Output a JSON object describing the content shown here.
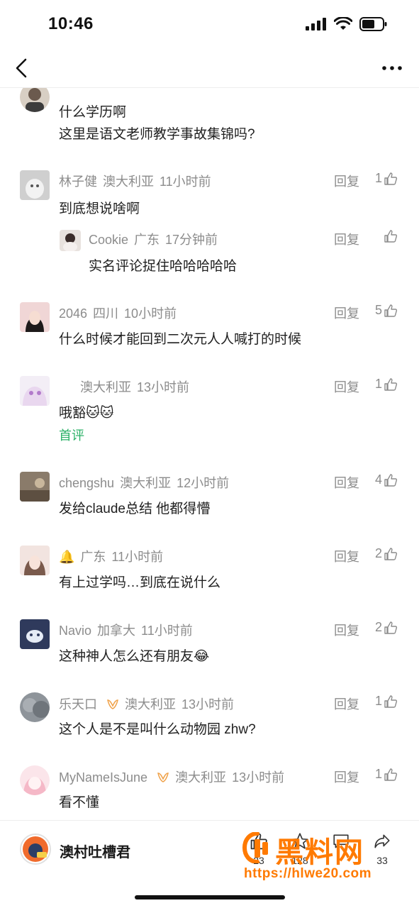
{
  "status_bar": {
    "time": "10:46"
  },
  "comments": [
    {
      "name": "",
      "location": "",
      "time": "",
      "text": "什么学历啊",
      "text2": "这里是语文老师教学事故集锦吗?",
      "likes": ""
    },
    {
      "name": "林子健",
      "location": "澳大利亚",
      "time": "11小时前",
      "text": "到底想说啥啊",
      "reply_label": "回复",
      "likes": "1"
    },
    {
      "name": "Cookie",
      "location": "广东",
      "time": "17分钟前",
      "text": "实名评论捉住哈哈哈哈哈",
      "reply_label": "回复",
      "likes": ""
    },
    {
      "name": "2046",
      "location": "四川",
      "time": "10小时前",
      "text": "什么时候才能回到二次元人人喊打的时候",
      "reply_label": "回复",
      "likes": "5"
    },
    {
      "name": "",
      "location": "澳大利亚",
      "time": "13小时前",
      "text": "哦豁🐱🐱",
      "first_tag": "首评",
      "reply_label": "回复",
      "likes": "1"
    },
    {
      "name": "chengshu",
      "location": "澳大利亚",
      "time": "12小时前",
      "text": "发给claude总结 他都得懵",
      "reply_label": "回复",
      "likes": "4"
    },
    {
      "name": "🔔",
      "location": "广东",
      "time": "11小时前",
      "text": "有上过学吗…到底在说什么",
      "reply_label": "回复",
      "likes": "2"
    },
    {
      "name": "Navio",
      "location": "加拿大",
      "time": "11小时前",
      "text": "这种神人怎么还有朋友😂",
      "reply_label": "回复",
      "likes": "2"
    },
    {
      "name": "乐天口",
      "location": "澳大利亚",
      "time": "13小时前",
      "text": "这个人是不是叫什么动物园 zhw?",
      "reply_label": "回复",
      "likes": "1"
    },
    {
      "name": "MyNameIsJune",
      "location": "澳大利亚",
      "time": "13小时前",
      "text": "看不懂",
      "reply_label": "回复",
      "likes": "1"
    }
  ],
  "bottom_bar": {
    "account_name": "澳村吐槽君",
    "counts": [
      "23",
      "128",
      "",
      "33"
    ]
  },
  "watermark": {
    "title": "黑料网",
    "url": "https://hlwe20.com"
  },
  "colors": {
    "accent_green": "#2bb167",
    "watermark_orange": "#ff7a00",
    "meta_gray": "#8c8c8c"
  }
}
